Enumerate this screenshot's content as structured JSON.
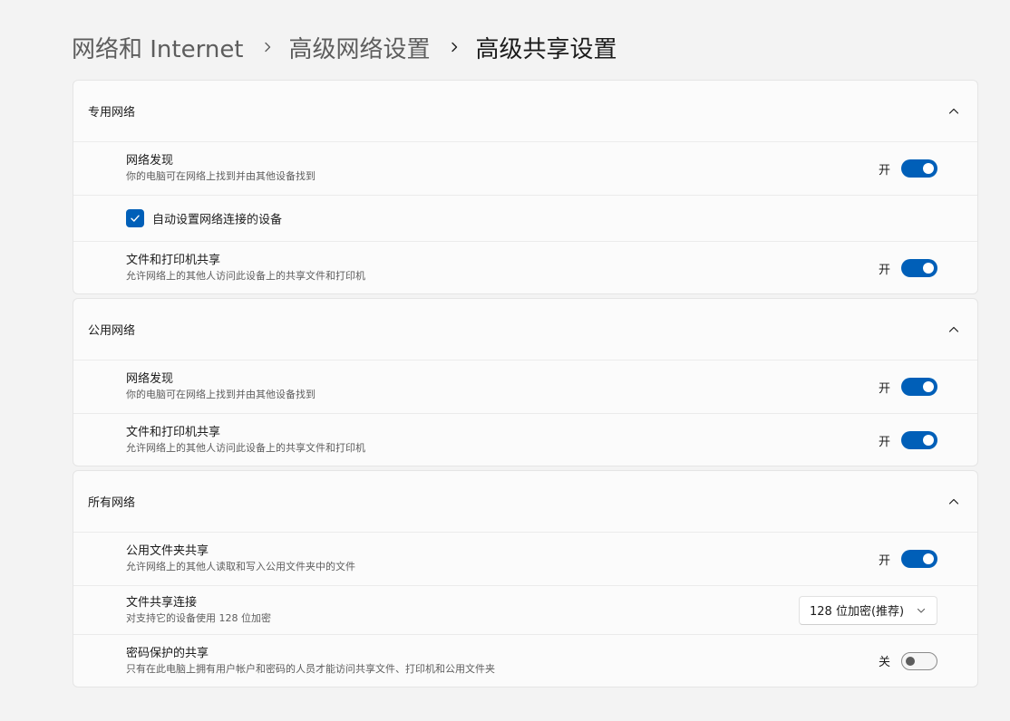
{
  "breadcrumb": {
    "items": [
      "网络和 Internet",
      "高级网络设置",
      "高级共享设置"
    ]
  },
  "sections": {
    "private": {
      "title": "专用网络",
      "network_discovery": {
        "title": "网络发现",
        "desc": "你的电脑可在网络上找到并由其他设备找到",
        "state_label": "开",
        "on": true
      },
      "auto_setup": {
        "label": "自动设置网络连接的设备",
        "checked": true
      },
      "file_printer": {
        "title": "文件和打印机共享",
        "desc": "允许网络上的其他人访问此设备上的共享文件和打印机",
        "state_label": "开",
        "on": true
      }
    },
    "public": {
      "title": "公用网络",
      "network_discovery": {
        "title": "网络发现",
        "desc": "你的电脑可在网络上找到并由其他设备找到",
        "state_label": "开",
        "on": true
      },
      "file_printer": {
        "title": "文件和打印机共享",
        "desc": "允许网络上的其他人访问此设备上的共享文件和打印机",
        "state_label": "开",
        "on": true
      }
    },
    "all": {
      "title": "所有网络",
      "public_folder": {
        "title": "公用文件夹共享",
        "desc": "允许网络上的其他人读取和写入公用文件夹中的文件",
        "state_label": "开",
        "on": true
      },
      "file_sharing_conn": {
        "title": "文件共享连接",
        "desc": "对支持它的设备使用 128 位加密",
        "selected": "128 位加密(推荐)"
      },
      "password_protected": {
        "title": "密码保护的共享",
        "desc": "只有在此电脑上拥有用户帐户和密码的人员才能访问共享文件、打印机和公用文件夹",
        "state_label": "关",
        "on": false
      }
    }
  },
  "colors": {
    "accent": "#005fb8",
    "background": "#f3f3f3",
    "card": "#fbfbfb"
  },
  "icons": {
    "breadcrumb_separator": "chevron-right-icon",
    "section_collapse": "chevron-up-icon",
    "dropdown": "chevron-down-icon",
    "checkbox": "checkmark-icon"
  }
}
